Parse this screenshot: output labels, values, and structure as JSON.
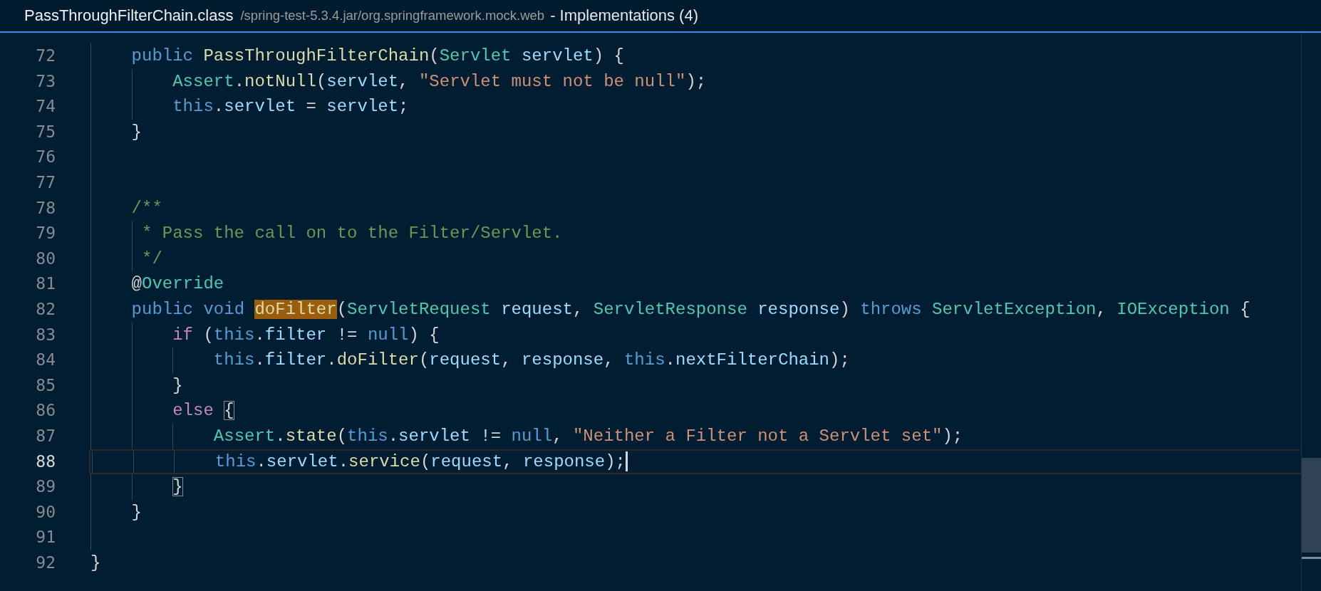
{
  "peek_header": {
    "file_name": "PassThroughFilterChain.class",
    "path": "/spring-test-5.3.4.jar/org.springframework.mock.web",
    "title": "- Implementations (4)"
  },
  "lines": [
    {
      "number": "72",
      "current": false,
      "tokens": [
        {
          "text": "    public ",
          "kind": "keyword"
        },
        {
          "text": "PassThroughFilterChain",
          "kind": "function"
        },
        {
          "text": "(",
          "kind": "plain"
        },
        {
          "text": "Servlet ",
          "kind": "type"
        },
        {
          "text": "servlet",
          "kind": "variable"
        },
        {
          "text": ") {",
          "kind": "plain"
        }
      ]
    },
    {
      "number": "73",
      "current": false,
      "tokens": [
        {
          "text": "        Assert",
          "kind": "type"
        },
        {
          "text": ".",
          "kind": "plain"
        },
        {
          "text": "notNull",
          "kind": "function"
        },
        {
          "text": "(",
          "kind": "plain"
        },
        {
          "text": "servlet",
          "kind": "variable"
        },
        {
          "text": ", ",
          "kind": "plain"
        },
        {
          "text": "\"Servlet must not be null\"",
          "kind": "string"
        },
        {
          "text": ");",
          "kind": "plain"
        }
      ]
    },
    {
      "number": "74",
      "current": false,
      "tokens": [
        {
          "text": "        this",
          "kind": "keyword"
        },
        {
          "text": ".",
          "kind": "plain"
        },
        {
          "text": "servlet",
          "kind": "variable"
        },
        {
          "text": " = ",
          "kind": "plain"
        },
        {
          "text": "servlet",
          "kind": "variable"
        },
        {
          "text": ";",
          "kind": "plain"
        }
      ]
    },
    {
      "number": "75",
      "current": false,
      "tokens": [
        {
          "text": "    }",
          "kind": "plain"
        }
      ]
    },
    {
      "number": "76",
      "current": false
    },
    {
      "number": "77",
      "current": false
    },
    {
      "number": "78",
      "current": false,
      "tokens": [
        {
          "text": "    /**",
          "kind": "comment"
        }
      ]
    },
    {
      "number": "79",
      "current": false,
      "tokens": [
        {
          "text": "     * Pass the call on to the Filter/Servlet.",
          "kind": "comment"
        }
      ]
    },
    {
      "number": "80",
      "current": false,
      "tokens": [
        {
          "text": "     */",
          "kind": "comment"
        }
      ]
    },
    {
      "number": "81",
      "current": false,
      "tokens": [
        {
          "text": "    @",
          "kind": "plain"
        },
        {
          "text": "Override",
          "kind": "type"
        }
      ]
    },
    {
      "number": "82",
      "current": false,
      "tokens": [
        {
          "text": "    public ",
          "kind": "keyword"
        },
        {
          "text": "void ",
          "kind": "keyword"
        },
        {
          "text": "doFilter",
          "kind": "function",
          "highlighted": true
        },
        {
          "text": "(",
          "kind": "plain"
        },
        {
          "text": "ServletRequest ",
          "kind": "type"
        },
        {
          "text": "request",
          "kind": "variable"
        },
        {
          "text": ", ",
          "kind": "plain"
        },
        {
          "text": "ServletResponse ",
          "kind": "type"
        },
        {
          "text": "response",
          "kind": "variable"
        },
        {
          "text": ") ",
          "kind": "plain"
        },
        {
          "text": "throws ",
          "kind": "keyword"
        },
        {
          "text": "ServletException",
          "kind": "type"
        },
        {
          "text": ", ",
          "kind": "plain"
        },
        {
          "text": "IOException",
          "kind": "type"
        },
        {
          "text": " {",
          "kind": "plain"
        }
      ]
    },
    {
      "number": "83",
      "current": false,
      "tokens": [
        {
          "text": "        if",
          "kind": "control"
        },
        {
          "text": " (",
          "kind": "plain"
        },
        {
          "text": "this",
          "kind": "keyword"
        },
        {
          "text": ".",
          "kind": "plain"
        },
        {
          "text": "filter",
          "kind": "variable"
        },
        {
          "text": " != ",
          "kind": "plain"
        },
        {
          "text": "null",
          "kind": "keyword"
        },
        {
          "text": ") {",
          "kind": "plain"
        }
      ]
    },
    {
      "number": "84",
      "current": false,
      "tokens": [
        {
          "text": "            this",
          "kind": "keyword"
        },
        {
          "text": ".",
          "kind": "plain"
        },
        {
          "text": "filter",
          "kind": "variable"
        },
        {
          "text": ".",
          "kind": "plain"
        },
        {
          "text": "doFilter",
          "kind": "function"
        },
        {
          "text": "(",
          "kind": "plain"
        },
        {
          "text": "request",
          "kind": "variable"
        },
        {
          "text": ", ",
          "kind": "plain"
        },
        {
          "text": "response",
          "kind": "variable"
        },
        {
          "text": ", ",
          "kind": "plain"
        },
        {
          "text": "this",
          "kind": "keyword"
        },
        {
          "text": ".",
          "kind": "plain"
        },
        {
          "text": "nextFilterChain",
          "kind": "variable"
        },
        {
          "text": ");",
          "kind": "plain"
        }
      ]
    },
    {
      "number": "85",
      "current": false,
      "tokens": [
        {
          "text": "        }",
          "kind": "plain"
        }
      ]
    },
    {
      "number": "86",
      "current": false,
      "tokens": [
        {
          "text": "        else ",
          "kind": "control"
        },
        {
          "text": "{",
          "kind": "plain",
          "bracket_match": true
        }
      ]
    },
    {
      "number": "87",
      "current": false,
      "tokens": [
        {
          "text": "            Assert",
          "kind": "type"
        },
        {
          "text": ".",
          "kind": "plain"
        },
        {
          "text": "state",
          "kind": "function"
        },
        {
          "text": "(",
          "kind": "plain"
        },
        {
          "text": "this",
          "kind": "keyword"
        },
        {
          "text": ".",
          "kind": "plain"
        },
        {
          "text": "servlet",
          "kind": "variable"
        },
        {
          "text": " != ",
          "kind": "plain"
        },
        {
          "text": "null",
          "kind": "keyword"
        },
        {
          "text": ", ",
          "kind": "plain"
        },
        {
          "text": "\"Neither a Filter not a Servlet set\"",
          "kind": "string"
        },
        {
          "text": ");",
          "kind": "plain"
        }
      ]
    },
    {
      "number": "88",
      "current": true,
      "tokens": [
        {
          "text": "            this",
          "kind": "keyword"
        },
        {
          "text": ".",
          "kind": "plain"
        },
        {
          "text": "servlet",
          "kind": "variable"
        },
        {
          "text": ".",
          "kind": "plain"
        },
        {
          "text": "service",
          "kind": "function"
        },
        {
          "text": "(",
          "kind": "plain"
        },
        {
          "text": "request",
          "kind": "variable"
        },
        {
          "text": ", ",
          "kind": "plain"
        },
        {
          "text": "response",
          "kind": "variable"
        },
        {
          "text": ");",
          "kind": "plain"
        }
      ]
    },
    {
      "number": "89",
      "current": false,
      "tokens": [
        {
          "text": "        }",
          "kind": "plain",
          "bracket_match": true
        }
      ]
    },
    {
      "number": "90",
      "current": false,
      "tokens": [
        {
          "text": "    }",
          "kind": "plain"
        }
      ]
    },
    {
      "number": "91",
      "current": false
    },
    {
      "number": "92",
      "current": false,
      "tokens": [
        {
          "text": "}",
          "kind": "plain"
        }
      ]
    }
  ]
}
